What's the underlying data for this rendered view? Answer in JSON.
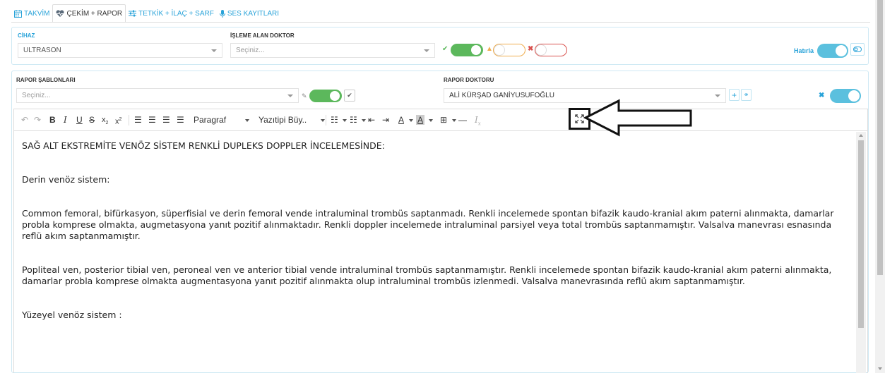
{
  "tabs": [
    {
      "label": "TAKVİM",
      "icon": "calendar-icon"
    },
    {
      "label": "ÇEKİM + RAPOR",
      "icon": "heartbeat-icon"
    },
    {
      "label": "TETKİK + İLAÇ + SARF",
      "icon": "sliders-icon"
    },
    {
      "label": "SES KAYITLARI",
      "icon": "microphone-icon"
    }
  ],
  "panel1": {
    "cihaz_label": "CİHAZ",
    "cihaz_value": "ULTRASON",
    "doktor_label": "İŞLEME ALAN DOKTOR",
    "doktor_placeholder": "Seçiniz...",
    "hatirla_label": "Hatırla"
  },
  "panel2": {
    "sablon_label": "RAPOR ŞABLONLARI",
    "sablon_placeholder": "Seçiniz...",
    "rapor_doktor_label": "RAPOR DOKTORU",
    "rapor_doktor_value": "ALİ KÜRŞAD GANİYUSUFOĞLU"
  },
  "toolbar": {
    "paragraph": "Paragraf",
    "font_size": "Yazıtipi Büy.."
  },
  "colors": {
    "accent": "#29a3d9",
    "switch_on": "#5bc0de",
    "green": "#5cb85c",
    "warning": "#f0ad4e",
    "danger": "#d9534f"
  },
  "content": {
    "heading": "SAĞ ALT EKSTREMİTE VENÖZ SİSTEM RENKLİ DUPLEKS DOPPLER İNCELEMESİNDE:",
    "section1": "Derin venöz sistem:",
    "paragraph1": "Common femoral, bifürkasyon, süperfisial ve derin femoral vende  intraluminal trombüs saptanmadı. Renkli incelemede spontan bifazik kaudo-kranial akım paterni alınmakta, damarlar probla komprese olmakta, augmetasyona yanıt pozitif alınmaktadır. Renkli doppler incelemede intraluminal parsiyel veya total trombüs saptanmamıştır. Valsalva manevrası esnasında reflü akım saptanmamıştır.",
    "paragraph2": "Popliteal ven, posterior tibial ven, peroneal ven ve anterior tibial vende intraluminal trombüs saptanmamıştır. Renkli incelemede spontan bifazik kaudo-kranial akım paterni alınmakta, damarlar probla komprese olmakta augmentasyona yanıt pozitif alınmakta olup intraluminal trombüs izlenmedi. Valsalva manevrasında reflü akım saptanmamıştır.",
    "section2": "Yüzeyel venöz sistem :"
  }
}
